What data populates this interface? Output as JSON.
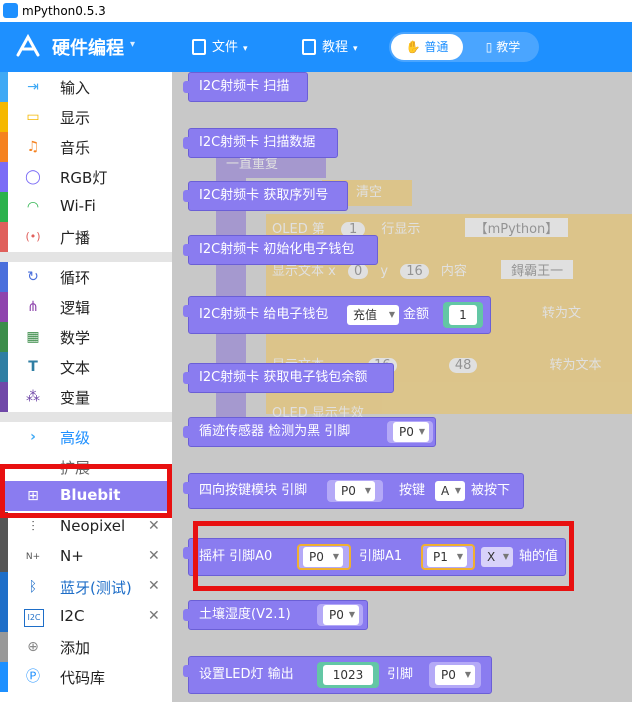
{
  "window": {
    "title": "mPython0.5.3"
  },
  "header": {
    "mode_title": "硬件编程",
    "menu": [
      {
        "label": "文件"
      },
      {
        "label": "教程"
      }
    ],
    "toggle": {
      "on": "普通",
      "off": "教学"
    }
  },
  "sidebar": {
    "categories": [
      {
        "label": "输入",
        "icon": "input-icon",
        "color": "#3fa9f5"
      },
      {
        "label": "显示",
        "icon": "monitor-icon",
        "color": "#f5b800"
      },
      {
        "label": "音乐",
        "icon": "music-icon",
        "color": "#f58220"
      },
      {
        "label": "RGB灯",
        "icon": "bulb-icon",
        "color": "#7b6cf6"
      },
      {
        "label": "Wi-Fi",
        "icon": "wifi-icon",
        "color": "#2bb24c"
      },
      {
        "label": "广播",
        "icon": "broadcast-icon",
        "color": "#e0605c"
      },
      {
        "label": "循环",
        "icon": "loop-icon",
        "color": "#4a6fdc"
      },
      {
        "label": "逻辑",
        "icon": "logic-icon",
        "color": "#8e44ad"
      },
      {
        "label": "数学",
        "icon": "calculator-icon",
        "color": "#3c8d4a"
      },
      {
        "label": "文本",
        "icon": "text-icon",
        "color": "#2f7ea3"
      },
      {
        "label": "变量",
        "icon": "variable-icon",
        "color": "#7048a8"
      },
      {
        "label": "高级",
        "icon": "chevron-right-icon",
        "color": "#3fa9f5"
      },
      {
        "label": "扩展",
        "icon": "dots-icon",
        "color": "#888888"
      },
      {
        "label": "Bluebit",
        "icon": "bluebit-icon",
        "color": "#8a7cf0"
      },
      {
        "label": "Neopixel",
        "icon": "sliders-icon",
        "color": "#555555"
      },
      {
        "label": "N+",
        "icon": "nplus-icon",
        "color": "#555555"
      },
      {
        "label": "蓝牙(测试)",
        "icon": "bluetooth-icon",
        "color": "#1e6ec8"
      },
      {
        "label": "I2C",
        "icon": "i2c-icon",
        "color": "#1e6ec8"
      },
      {
        "label": "添加",
        "icon": "plus-circle-icon",
        "color": "#888888"
      },
      {
        "label": "代码库",
        "icon": "library-icon",
        "color": "#1e90ff"
      }
    ]
  },
  "blocks": [
    {
      "text": "I2C射频卡 扫描"
    },
    {
      "text": "I2C射频卡 扫描数据"
    },
    {
      "text": "I2C射频卡 获取序列号"
    },
    {
      "text": "I2C射频卡 初始化电子钱包"
    },
    {
      "text": "I2C射频卡 给电子钱包",
      "dd1": "充值",
      "t2": "金额",
      "num": "1"
    },
    {
      "text": "I2C射频卡 获取电子钱包余额"
    },
    {
      "text": "循迹传感器 检测为黑 引脚",
      "dd1": "P0"
    },
    {
      "text": "四向按键模块 引脚",
      "dd1": "P0",
      "t2": "按键",
      "dd2": "A",
      "t3": "被按下"
    },
    {
      "text": "摇杆 引脚A0",
      "dd1": "P0",
      "t2": "引脚A1",
      "dd2": "P1",
      "dd3": "X",
      "t3": "轴的值"
    },
    {
      "text": "土壤湿度(V2.1)",
      "dd1": "P0"
    },
    {
      "text": "设置LED灯 输出",
      "num": "1023",
      "t2": "引脚",
      "dd1": "P0"
    }
  ],
  "ghost": {
    "t1": "一直重复",
    "t2": "清空",
    "t3": "OLED 第",
    "n1": "1",
    "t4": "行显示",
    "s1": "【mPython】",
    "t5": "显示文本 x",
    "n2": "0",
    "t6": "y",
    "n3": "16",
    "t7": "内容",
    "s2": "鍀霸王一",
    "t8": "转为文",
    "t9": "显示文本",
    "n4": "16",
    "n5": "48",
    "t10": "转为文本",
    "t11": "OLED 显示生效"
  }
}
